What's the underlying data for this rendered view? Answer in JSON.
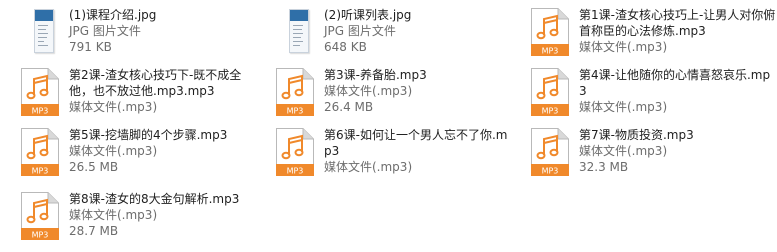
{
  "files": [
    {
      "id": "jpg1",
      "kind": "jpg",
      "name": "(1)课程介绍.jpg",
      "type": "JPG 图片文件",
      "size": "791 KB"
    },
    {
      "id": "jpg2",
      "kind": "jpg",
      "name": "(2)听课列表.jpg",
      "type": "JPG 图片文件",
      "size": "648 KB"
    },
    {
      "id": "l1",
      "kind": "mp3",
      "name": "第1课-渣女核心技巧上-让男人对你俯首称臣的心法修炼.mp3",
      "type": "媒体文件(.mp3)",
      "size": ""
    },
    {
      "id": "l2",
      "kind": "mp3",
      "name": "第2课-渣女核心技巧下-既不成全他，也不放过他.mp3.mp3",
      "type": "媒体文件(.mp3)",
      "size": ""
    },
    {
      "id": "l3",
      "kind": "mp3",
      "name": "第3课-养备胎.mp3",
      "type": "媒体文件(.mp3)",
      "size": "26.4 MB"
    },
    {
      "id": "l4",
      "kind": "mp3",
      "name": "第4课-让他随你的心情喜怒哀乐.mp3",
      "type": "媒体文件(.mp3)",
      "size": ""
    },
    {
      "id": "l5",
      "kind": "mp3",
      "name": "第5课-挖墙脚的4个步骤.mp3",
      "type": "媒体文件(.mp3)",
      "size": "26.5 MB"
    },
    {
      "id": "l6",
      "kind": "mp3",
      "name": "第6课-如何让一个男人忘不了你.mp3",
      "type": "媒体文件(.mp3)",
      "size": ""
    },
    {
      "id": "l7",
      "kind": "mp3",
      "name": "第7课-物质投资.mp3",
      "type": "媒体文件(.mp3)",
      "size": "32.3 MB"
    },
    {
      "id": "l8",
      "kind": "mp3",
      "name": "第8课-渣女的8大金句解析.mp3",
      "type": "媒体文件(.mp3)",
      "size": "28.7 MB"
    }
  ],
  "mp3_badge": "MP3",
  "colors": {
    "badge": "#f0892b",
    "note": "#f0892b",
    "page_fold": "#d9d9d9"
  }
}
